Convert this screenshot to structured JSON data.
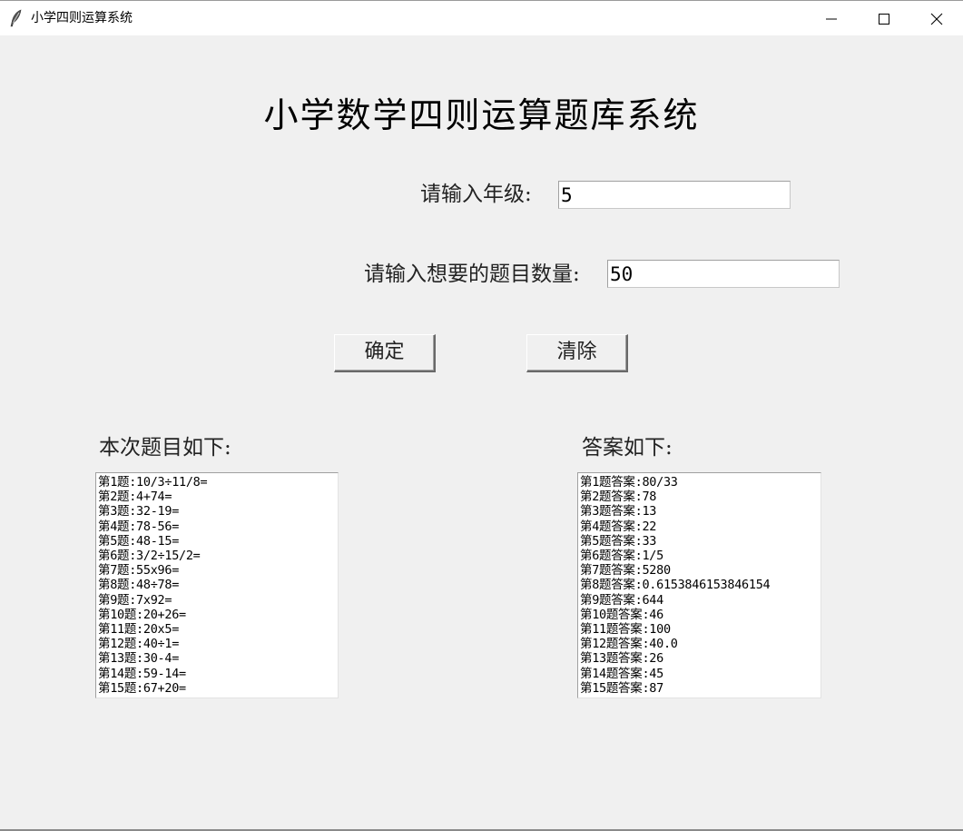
{
  "window": {
    "title": "小学四则运算系统",
    "icon": "feather-icon",
    "controls": [
      "minimize-icon",
      "maximize-icon",
      "close-icon"
    ]
  },
  "main": {
    "heading": "小学数学四则运算题库系统",
    "grade": {
      "label": "请输入年级:",
      "value": "5"
    },
    "count": {
      "label": "请输入想要的题目数量:",
      "value": "50"
    },
    "buttons": {
      "confirm": "确定",
      "clear": "清除"
    },
    "questions": {
      "label": "本次题目如下:",
      "lines": [
        "第1题:10/3÷11/8=",
        "第2题:4+74=",
        "第3题:32-19=",
        "第4题:78-56=",
        "第5题:48-15=",
        "第6题:3/2÷15/2=",
        "第7题:55x96=",
        "第8题:48÷78=",
        "第9题:7x92=",
        "第10题:20+26=",
        "第11题:20x5=",
        "第12题:40÷1=",
        "第13题:30-4=",
        "第14题:59-14=",
        "第15题:67+20="
      ]
    },
    "answers": {
      "label": "答案如下:",
      "lines": [
        "第1题答案:80/33",
        "第2题答案:78",
        "第3题答案:13",
        "第4题答案:22",
        "第5题答案:33",
        "第6题答案:1/5",
        "第7题答案:5280",
        "第8题答案:0.6153846153846154",
        "第9题答案:644",
        "第10题答案:46",
        "第11题答案:100",
        "第12题答案:40.0",
        "第13题答案:26",
        "第14题答案:45",
        "第15题答案:87"
      ]
    }
  }
}
